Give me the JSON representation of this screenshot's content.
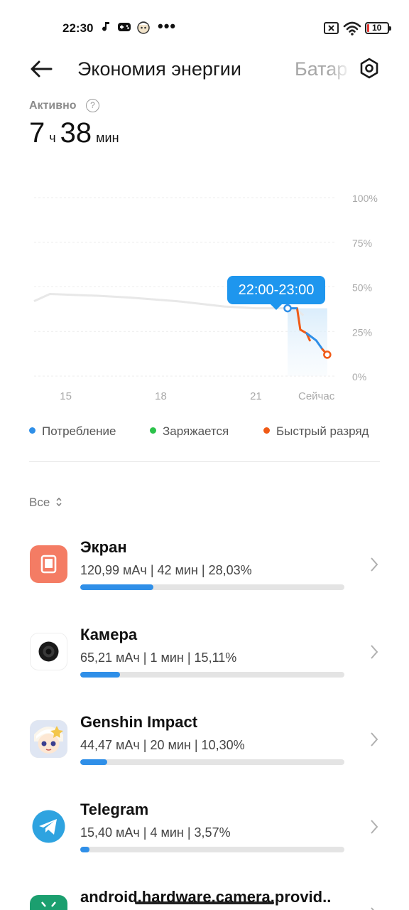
{
  "status_bar": {
    "time": "22:30",
    "battery_level": "10",
    "icons": [
      "music-note-icon",
      "gamepad-icon",
      "genshin-notification-icon",
      "more-dots-icon",
      "sim-off-icon",
      "wifi-icon",
      "battery-icon"
    ],
    "more": "•••"
  },
  "header": {
    "title": "Экономия энергии",
    "second_tab": "Батар"
  },
  "active": {
    "label": "Активно",
    "hours": "7",
    "hours_unit": "ч",
    "minutes": "38",
    "minutes_unit": "мин",
    "help_symbol": "?"
  },
  "chart_data": {
    "type": "line",
    "title": "",
    "x_ticks": [
      "15",
      "18",
      "21",
      "Сейчас"
    ],
    "y_ticks": [
      "100%",
      "75%",
      "50%",
      "25%",
      "0%"
    ],
    "ylim": [
      0,
      100
    ],
    "grid": true,
    "tooltip": "22:00-23:00",
    "series": [
      {
        "name": "Потребление",
        "color": "#2f8fe8",
        "x": [
          14.0,
          14.5,
          16.0,
          17.0,
          18.5,
          20.0,
          21.0,
          21.8,
          22.0,
          22.3,
          22.5
        ],
        "y": [
          42,
          46,
          45,
          44,
          42,
          39,
          38,
          38,
          38,
          37,
          34
        ]
      },
      {
        "name": "Быстрый разряд",
        "color": "#f05a16",
        "x": [
          22.3,
          22.4,
          22.6,
          22.7
        ],
        "y": [
          38,
          26,
          24,
          20
        ]
      },
      {
        "name": "Потребление",
        "color": "#2f8fe8",
        "x": [
          22.6,
          22.9,
          23.1
        ],
        "y": [
          24,
          20,
          15
        ]
      },
      {
        "name": "Быстрый разряд",
        "color": "#f05a16",
        "x": [
          23.1,
          23.25
        ],
        "y": [
          15,
          12
        ]
      }
    ],
    "legend": [
      {
        "label": "Потребление",
        "color": "#2f8fe8"
      },
      {
        "label": "Заряжается",
        "color": "#2bc24a"
      },
      {
        "label": "Быстрый разряд",
        "color": "#f05a16"
      }
    ]
  },
  "filter": {
    "label": "Все",
    "icon": "sort-toggle-icon"
  },
  "apps": [
    {
      "name": "Экран",
      "stats": "120,99 мАч | 42 мин  | 28,03%",
      "percent": 28.03,
      "icon": "screen-icon",
      "icon_color": "#f47c64"
    },
    {
      "name": "Камера",
      "stats": "65,21 мАч | 1 мин  | 15,11%",
      "percent": 15.11,
      "icon": "camera-icon",
      "icon_color": "#ffffff"
    },
    {
      "name": "Genshin Impact",
      "stats": "44,47 мАч | 20 мин  | 10,30%",
      "percent": 10.3,
      "icon": "genshin-impact-icon",
      "icon_color": "#f2e2c8"
    },
    {
      "name": "Telegram",
      "stats": "15,40 мАч | 4 мин  | 3,57%",
      "percent": 3.57,
      "icon": "telegram-icon",
      "icon_color": "#2ea3e0"
    },
    {
      "name": "android.hardware.camera.provid..",
      "stats": "",
      "percent": 0,
      "icon": "android-icon",
      "icon_color": "#1b9f6f"
    }
  ]
}
